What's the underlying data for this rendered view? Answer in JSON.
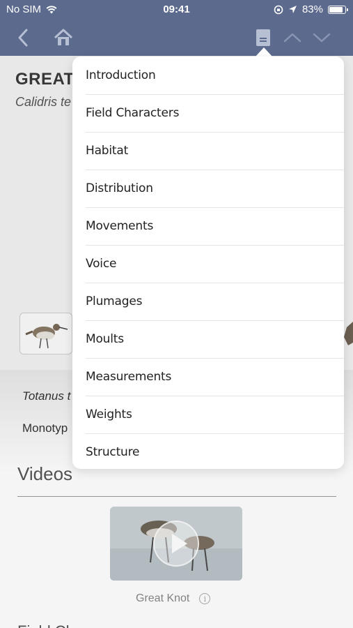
{
  "status_bar": {
    "carrier": "No SIM",
    "time": "09:41",
    "battery": "83%",
    "battery_level": 0.83
  },
  "nav_bar": {
    "back_icon": "chevron-left-icon",
    "home_icon": "home-icon",
    "contents_icon": "document-icon",
    "prev_icon": "chevron-up-icon",
    "next_icon": "chevron-down-icon",
    "bar_color": "#5c6a8e"
  },
  "species": {
    "name_partial": "GREAT K",
    "scientific_partial": "Calidris te"
  },
  "taxonomy": {
    "synonym_partial": "Totanus t",
    "status_partial": "Monotyp"
  },
  "videos": {
    "heading": "Videos",
    "items": [
      {
        "caption": "Great Knot"
      }
    ]
  },
  "next_section_partial": "Field Ch",
  "contents_menu": {
    "items": [
      "Introduction",
      "Field Characters",
      "Habitat",
      "Distribution",
      "Movements",
      "Voice",
      "Plumages",
      "Moults",
      "Measurements",
      "Weights",
      "Structure"
    ]
  }
}
